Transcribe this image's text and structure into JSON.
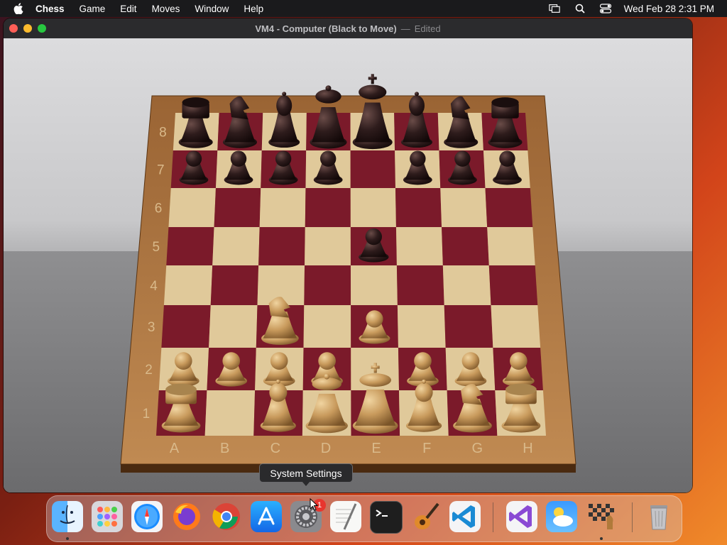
{
  "menubar": {
    "app_name": "Chess",
    "items": [
      "Game",
      "Edit",
      "Moves",
      "Window",
      "Help"
    ],
    "clock": "Wed Feb 28  2:31 PM"
  },
  "window": {
    "title": "VM4 - Computer  (Black to Move)",
    "separator": "—",
    "status": "Edited"
  },
  "board": {
    "files": [
      "A",
      "B",
      "C",
      "D",
      "E",
      "F",
      "G",
      "H"
    ],
    "ranks": [
      "8",
      "7",
      "6",
      "5",
      "4",
      "3",
      "2",
      "1"
    ],
    "pieces": [
      {
        "square": "a8",
        "piece": "black-rook"
      },
      {
        "square": "b8",
        "piece": "black-knight"
      },
      {
        "square": "c8",
        "piece": "black-bishop"
      },
      {
        "square": "d8",
        "piece": "black-queen"
      },
      {
        "square": "e8",
        "piece": "black-king"
      },
      {
        "square": "f8",
        "piece": "black-bishop"
      },
      {
        "square": "g8",
        "piece": "black-knight"
      },
      {
        "square": "h8",
        "piece": "black-rook"
      },
      {
        "square": "a7",
        "piece": "black-pawn"
      },
      {
        "square": "b7",
        "piece": "black-pawn"
      },
      {
        "square": "c7",
        "piece": "black-pawn"
      },
      {
        "square": "d7",
        "piece": "black-pawn"
      },
      {
        "square": "f7",
        "piece": "black-pawn"
      },
      {
        "square": "g7",
        "piece": "black-pawn"
      },
      {
        "square": "h7",
        "piece": "black-pawn"
      },
      {
        "square": "e5",
        "piece": "black-pawn"
      },
      {
        "square": "c3",
        "piece": "white-knight"
      },
      {
        "square": "e3",
        "piece": "white-pawn"
      },
      {
        "square": "a2",
        "piece": "white-pawn"
      },
      {
        "square": "b2",
        "piece": "white-pawn"
      },
      {
        "square": "c2",
        "piece": "white-pawn"
      },
      {
        "square": "d2",
        "piece": "white-pawn"
      },
      {
        "square": "f2",
        "piece": "white-pawn"
      },
      {
        "square": "g2",
        "piece": "white-pawn"
      },
      {
        "square": "h2",
        "piece": "white-pawn"
      },
      {
        "square": "a1",
        "piece": "white-rook"
      },
      {
        "square": "c1",
        "piece": "white-bishop"
      },
      {
        "square": "d1",
        "piece": "white-queen"
      },
      {
        "square": "e1",
        "piece": "white-king"
      },
      {
        "square": "f1",
        "piece": "white-bishop"
      },
      {
        "square": "g1",
        "piece": "white-knight"
      },
      {
        "square": "h1",
        "piece": "white-rook"
      }
    ]
  },
  "tooltip": "System Settings",
  "dock": {
    "apps": [
      "finder",
      "launchpad",
      "safari",
      "firefox",
      "chrome",
      "app-store",
      "system-settings",
      "textedit",
      "terminal",
      "garageband",
      "vscode",
      "visual-studio",
      "weather",
      "chess",
      "trash"
    ],
    "badge": "1"
  },
  "colors": {
    "dark_square": "#7b1a2a",
    "light_square": "#e0c99a",
    "board_frame": "#b07a45",
    "black_piece": "#2a1a1a",
    "white_piece": "#d2ab72"
  }
}
